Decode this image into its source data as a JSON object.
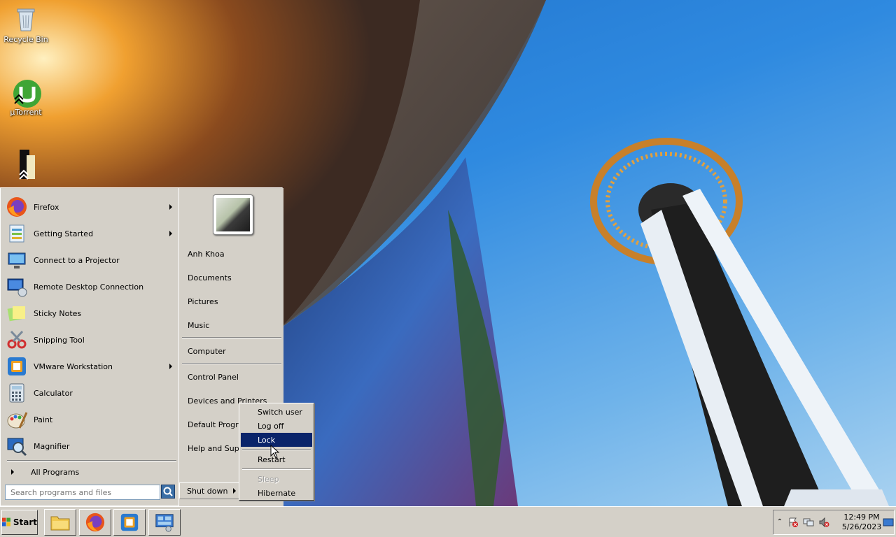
{
  "desktop": {
    "icons": [
      {
        "label": "Recycle Bin",
        "icon": "recycle-bin-icon"
      },
      {
        "label": "µTorrent",
        "icon": "utorrent-icon"
      },
      {
        "label": "",
        "icon": "shortcut-file-icon"
      }
    ]
  },
  "start_menu": {
    "programs": [
      {
        "label": "Firefox",
        "icon": "firefox-icon",
        "submenu": true
      },
      {
        "label": "Getting Started",
        "icon": "getting-started-icon",
        "submenu": true
      },
      {
        "label": "Connect to a Projector",
        "icon": "projector-icon",
        "submenu": false
      },
      {
        "label": "Remote Desktop Connection",
        "icon": "remote-desktop-icon",
        "submenu": false
      },
      {
        "label": "Sticky Notes",
        "icon": "sticky-notes-icon",
        "submenu": false
      },
      {
        "label": "Snipping Tool",
        "icon": "snipping-tool-icon",
        "submenu": false
      },
      {
        "label": "VMware Workstation",
        "icon": "vmware-icon",
        "submenu": true
      },
      {
        "label": "Calculator",
        "icon": "calculator-icon",
        "submenu": false
      },
      {
        "label": "Paint",
        "icon": "paint-icon",
        "submenu": false
      },
      {
        "label": "Magnifier",
        "icon": "magnifier-icon",
        "submenu": false
      }
    ],
    "all_programs": "All Programs",
    "search_placeholder": "Search programs and files",
    "user_name": "Anh Khoa",
    "right_links": [
      "Documents",
      "Pictures",
      "Music",
      "Computer",
      "Control Panel",
      "Devices and Printers",
      "Default Programs",
      "Help and Support"
    ],
    "shutdown_label": "Shut down"
  },
  "power_submenu": {
    "items": [
      {
        "label": "Switch user",
        "state": "normal"
      },
      {
        "label": "Log off",
        "state": "normal"
      },
      {
        "label": "Lock",
        "state": "selected"
      },
      {
        "label": "Restart",
        "state": "normal"
      },
      {
        "label": "Sleep",
        "state": "disabled"
      },
      {
        "label": "Hibernate",
        "state": "normal"
      }
    ]
  },
  "taskbar": {
    "start_label": "Start",
    "pinned": [
      "file-explorer-icon",
      "firefox-icon",
      "vmware-icon",
      "control-panel-icon"
    ],
    "tray_icons": [
      "show-hidden-icons-chevron",
      "action-center-icon",
      "network-icon",
      "volume-muted-icon"
    ],
    "time": "12:49 PM",
    "date": "5/26/2023"
  },
  "colors": {
    "menu_face": "#d4d0c8",
    "selection": "#0a246a",
    "sky": "#2f8ae0"
  }
}
